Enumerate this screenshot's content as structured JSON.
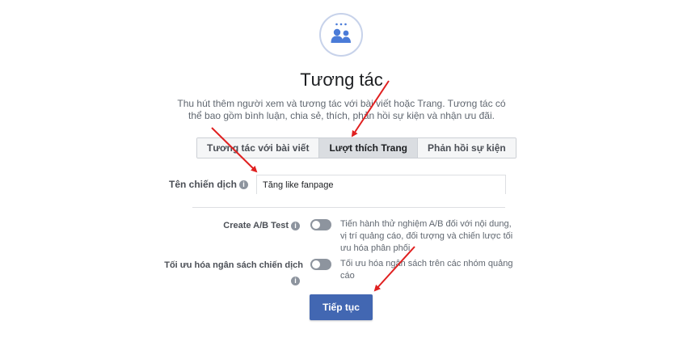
{
  "objective": {
    "icon": "people-group-icon",
    "title": "Tương tác",
    "description_line1": "Thu hút thêm người xem và tương tác với bài viết hoặc Trang. Tương tác có",
    "description_line2": "thể bao gồm bình luận, chia sẻ, thích, phản hồi sự kiện và nhận ưu đãi."
  },
  "tabs": [
    {
      "label": "Tương tác với bài viết",
      "active": false
    },
    {
      "label": "Lượt thích Trang",
      "active": true
    },
    {
      "label": "Phản hồi sự kiện",
      "active": false
    }
  ],
  "campaign": {
    "name_label": "Tên chiến dịch",
    "name_value": "Tăng like fanpage"
  },
  "ab_test": {
    "label": "Create A/B Test",
    "enabled": false,
    "description": "Tiến hành thử nghiệm A/B đối với nội dung, vị trí quảng cáo, đối tượng và chiến lược tối ưu hóa phân phối."
  },
  "budget_optimization": {
    "label": "Tối ưu hóa ngân sách chiến dịch",
    "enabled": false,
    "description": "Tối ưu hóa ngân sách trên các nhóm quảng cáo"
  },
  "continue_button": "Tiếp tục",
  "colors": {
    "primary": "#4267b2",
    "arrow": "#e02020",
    "icon_blue": "#4a7bd8"
  }
}
